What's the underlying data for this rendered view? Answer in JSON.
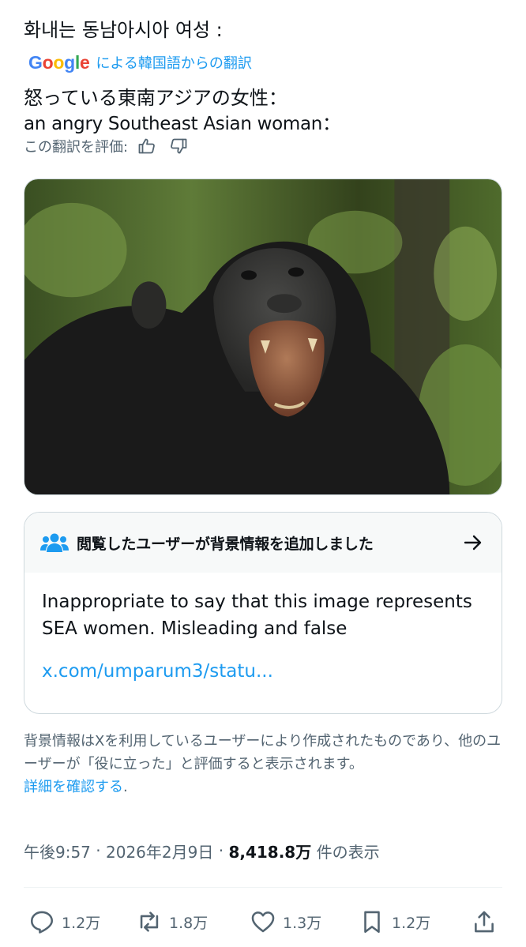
{
  "post": {
    "original_text": "화내는 동남아시아 여성 :",
    "translation": {
      "provider_logo": "Google",
      "label": "による韓国語からの翻訳",
      "text_ja": "怒っている東南アジアの女性：",
      "text_en": "an angry Southeast Asian woman："
    },
    "rate_label": "この翻訳を評価:",
    "rate_icons": [
      "thumbs-up-icon",
      "thumbs-down-icon"
    ]
  },
  "community_note": {
    "header": "閲覧したユーザーが背景情報を追加しました",
    "body": "Inappropriate to say that this image represents SEA women. Misleading and false",
    "link": "x.com/umparum3/statu..."
  },
  "disclaimer": {
    "text": "背景情報はXを利用しているユーザーにより作成されたものであり、他のユーザーが「役に立った」と評価すると表示されます。",
    "link": "詳細を確認する",
    "suffix": "."
  },
  "meta": {
    "time": "午後9:57",
    "separator": " · ",
    "date": "2026年2月9日",
    "views_count": "8,418.8万",
    "views_label": " 件の表示"
  },
  "actions": {
    "replies": "1.2万",
    "reposts": "1.8万",
    "likes": "1.3万",
    "bookmarks": "1.2万"
  },
  "colors": {
    "accent": "#1d9bf0",
    "text": "#0f1419",
    "muted": "#536471",
    "border": "#cfd9de"
  }
}
